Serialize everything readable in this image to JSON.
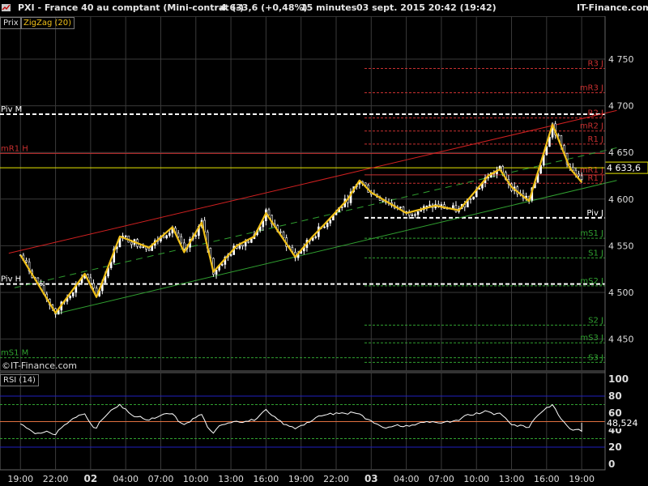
{
  "header": {
    "symbol": "PXI - France 40 au comptant (Mini-contrat  (-)",
    "price_change": "4 633,6 (+0,48%)",
    "interval": "15 minutes",
    "datetime": "03 sept. 2015 20:42 (19:42)",
    "source": "IT-Finance.com"
  },
  "main_panel": {
    "tab_label": "Prix",
    "indicator_label": "ZigZag (20)",
    "watermark": "©IT-Finance.com",
    "last_price_label": "4 633,6",
    "colors": {
      "background": "#000000",
      "grid": "#3a3a3a",
      "candle": "#ffffff",
      "zigzag": "#f0c018",
      "resistance_channel": "#d02020",
      "support_channel": "#30a030",
      "last_price_line": "#e8e800",
      "pivot": "#ffffff",
      "resistance_level": "#c83030",
      "support_level": "#30a030"
    }
  },
  "rsi_panel": {
    "label": "RSI (14)",
    "last_value_label": "48,524",
    "colors": {
      "line": "#ffffff",
      "bands": "#2020c0",
      "mid": "#e07040",
      "dashed": "#30a030"
    }
  },
  "chart_data": [
    {
      "type": "candlestick",
      "title": "PXI - France 40 au comptant (Mini-contrat  (-)",
      "interval": "15 minutes",
      "ylim": [
        4415,
        4795
      ],
      "y_ticks": [
        4450,
        4500,
        4550,
        4600,
        4650,
        4700,
        4750
      ],
      "y_tick_labels": [
        "4 450",
        "4 500",
        "4 550",
        "4 600",
        "4 650",
        "4 700",
        "4 750"
      ],
      "x_tick_labels": [
        "19:00",
        "22:00",
        "02",
        "04:00",
        "07:00",
        "10:00",
        "13:00",
        "16:00",
        "19:00",
        "22:00",
        "03",
        "04:00",
        "07:00",
        "10:00",
        "13:00",
        "16:00",
        "19:00"
      ],
      "last_price": 4633.6,
      "zigzag": [
        {
          "t": "01 sept. 19:00",
          "v": 4540
        },
        {
          "t": "01 sept. 22:00",
          "v": 4478
        },
        {
          "t": "02 sept. 00:30",
          "v": 4520
        },
        {
          "t": "02 sept. 01:30",
          "v": 4495
        },
        {
          "t": "02 sept. 03:30",
          "v": 4560
        },
        {
          "t": "02 sept. 06:00",
          "v": 4548
        },
        {
          "t": "02 sept. 08:00",
          "v": 4570
        },
        {
          "t": "02 sept. 09:00",
          "v": 4543
        },
        {
          "t": "02 sept. 10:30",
          "v": 4575
        },
        {
          "t": "02 sept. 11:30",
          "v": 4522
        },
        {
          "t": "02 sept. 13:30",
          "v": 4550
        },
        {
          "t": "02 sept. 15:00",
          "v": 4560
        },
        {
          "t": "02 sept. 16:00",
          "v": 4585
        },
        {
          "t": "02 sept. 18:30",
          "v": 4538
        },
        {
          "t": "02 sept. 20:00",
          "v": 4560
        },
        {
          "t": "02 sept. 21:00",
          "v": 4573
        },
        {
          "t": "02 sept. 23:00",
          "v": 4600
        },
        {
          "t": "03 sept. 00:00",
          "v": 4620
        },
        {
          "t": "03 sept. 01:00",
          "v": 4607
        },
        {
          "t": "03 sept. 04:00",
          "v": 4585
        },
        {
          "t": "03 sept. 06:30",
          "v": 4593
        },
        {
          "t": "03 sept. 08:30",
          "v": 4588
        },
        {
          "t": "03 sept. 10:00",
          "v": 4610
        },
        {
          "t": "03 sept. 11:00",
          "v": 4625
        },
        {
          "t": "03 sept. 12:00",
          "v": 4632
        },
        {
          "t": "03 sept. 13:00",
          "v": 4613
        },
        {
          "t": "03 sept. 14:30",
          "v": 4598
        },
        {
          "t": "03 sept. 16:30",
          "v": 4680
        },
        {
          "t": "03 sept. 18:00",
          "v": 4633
        },
        {
          "t": "03 sept. 19:00",
          "v": 4618
        }
      ],
      "trendlines": [
        {
          "name": "resistance-channel",
          "from": {
            "t": "01 sept. 18:00",
            "v": 4542
          },
          "to": {
            "t": "03 sept. 22:00",
            "v": 4695
          }
        },
        {
          "name": "support-channel",
          "from": {
            "t": "01 sept. 22:00",
            "v": 4477
          },
          "to": {
            "t": "03 sept. 22:00",
            "v": 4620
          }
        },
        {
          "name": "median-channel",
          "from": {
            "t": "01 sept. 18:30",
            "v": 4505
          },
          "to": {
            "t": "03 sept. 22:00",
            "v": 4655
          }
        }
      ],
      "levels": [
        {
          "label": "R3 J",
          "value": 4740,
          "style": "dashed",
          "group": "resistance"
        },
        {
          "label": "mR3 J",
          "value": 4714,
          "style": "dashed",
          "group": "resistance"
        },
        {
          "label": "R2 J",
          "value": 4687,
          "style": "dashed",
          "group": "resistance"
        },
        {
          "label": "mR2 J",
          "value": 4673,
          "style": "dashed",
          "group": "resistance"
        },
        {
          "label": "R1 J",
          "value": 4659,
          "style": "dashed",
          "group": "resistance"
        },
        {
          "label": "mR1 H",
          "value": 4649,
          "style": "solid",
          "group": "resistance"
        },
        {
          "label": "mR1 J",
          "value": 4626,
          "style": "solid",
          "group": "resistance"
        },
        {
          "label": "R1 J",
          "value": 4617,
          "style": "dashed",
          "group": "resistance"
        },
        {
          "label": "Piv M",
          "value": 4691,
          "style": "thick-dashed",
          "group": "pivot"
        },
        {
          "label": "Piv J",
          "value": 4580,
          "style": "thick-dashed",
          "group": "pivot"
        },
        {
          "label": "Piv H",
          "value": 4509,
          "style": "thick-dashed",
          "group": "pivot"
        },
        {
          "label": "mS1 J",
          "value": 4558,
          "style": "dashed",
          "group": "support"
        },
        {
          "label": "S1 J",
          "value": 4537,
          "style": "dashed",
          "group": "support"
        },
        {
          "label": "mS2 J",
          "value": 4507,
          "style": "dashed",
          "group": "support"
        },
        {
          "label": "S2 J",
          "value": 4465,
          "style": "dashed",
          "group": "support"
        },
        {
          "label": "mS3 J",
          "value": 4446,
          "style": "dashed",
          "group": "support"
        },
        {
          "label": "S3 J",
          "value": 4425,
          "style": "dashed",
          "group": "support"
        },
        {
          "label": "mS1 M",
          "value": 4430,
          "style": "dashed",
          "group": "support"
        }
      ]
    },
    {
      "type": "line",
      "title": "RSI (14)",
      "ylim": [
        0,
        100
      ],
      "y_ticks": [
        0,
        20,
        40,
        60,
        80,
        100
      ],
      "y_tick_labels": [
        "0",
        "20",
        "40",
        "60",
        "80",
        "100"
      ],
      "levels": [
        {
          "value": 80,
          "style": "solid"
        },
        {
          "value": 70,
          "style": "dashed"
        },
        {
          "value": 50,
          "style": "solid"
        },
        {
          "value": 30,
          "style": "dashed"
        },
        {
          "value": 20,
          "style": "solid"
        }
      ],
      "last_value": 48.524
    }
  ]
}
